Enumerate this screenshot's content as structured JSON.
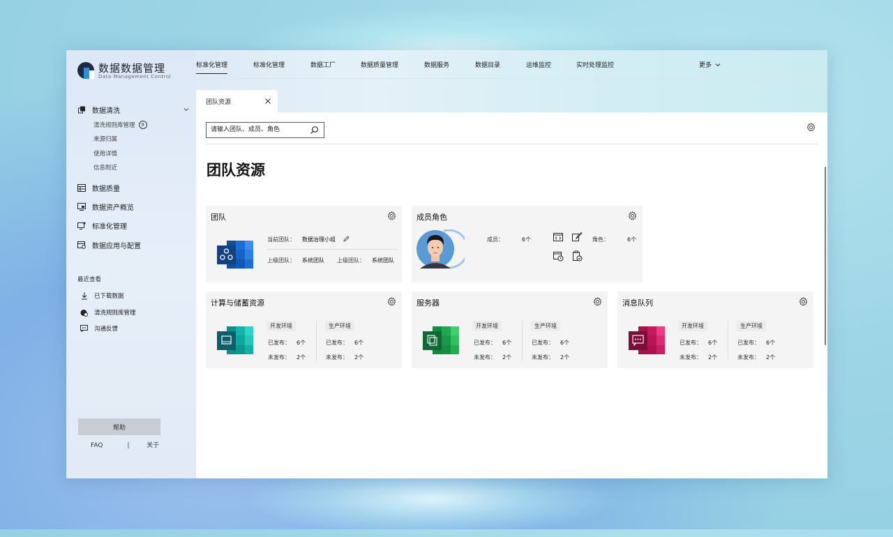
{
  "app": {
    "title": "数据数据管理",
    "subtitle": "Data Management Control"
  },
  "topnav": {
    "tabs": [
      "标准化管理",
      "标准化管理",
      "数据工厂",
      "数据质量管理",
      "数据服务",
      "数据目录",
      "运维监控",
      "实时处理监控"
    ],
    "more": "更多"
  },
  "sidebar": {
    "sections": [
      {
        "label": "数据清洗",
        "icon": "data-clean-icon",
        "children": [
          {
            "label": "清洗规则库管理",
            "badge": "9"
          },
          {
            "label": "来源归属"
          },
          {
            "label": "使用详情"
          },
          {
            "label": "信息附近"
          }
        ]
      },
      {
        "label": "数据质量",
        "icon": "data-quality-icon"
      },
      {
        "label": "数据资产概览",
        "icon": "asset-overview-icon"
      },
      {
        "label": "标准化管理",
        "icon": "standardization-icon"
      },
      {
        "label": "数据应用与配置",
        "icon": "app-config-icon"
      }
    ],
    "recent_title": "最近查看",
    "recent": [
      {
        "label": "已下载数据",
        "icon": "download-icon"
      },
      {
        "label": "清洗规则库管理",
        "icon": "rules-icon"
      },
      {
        "label": "沟通反馈",
        "icon": "chat-icon"
      }
    ],
    "help": "帮助",
    "faq": "FAQ",
    "sep": "|",
    "about": "关于"
  },
  "page_tab": {
    "label": "团队资源"
  },
  "search": {
    "placeholder": "请输入团队、成员、角色"
  },
  "page_title": "团队资源",
  "team_card": {
    "title": "团队",
    "current_team_label": "当前团队：",
    "current_team_value": "数据治理小组",
    "parent_team_label": "上级团队：",
    "parent_team_value": "系统团队",
    "parent_team_label2": "上级团队：",
    "parent_team_value2": "系统团队"
  },
  "member_card": {
    "title": "成员角色",
    "members_label": "成员：",
    "members_value": "6个",
    "roles_label": "角色：",
    "roles_value": "6个"
  },
  "resource_cards": [
    {
      "title": "计算与储蓄资源",
      "env1": "开发环境",
      "env2": "生产环境",
      "published": "已发布：",
      "unpublished": "未发布：",
      "dev_pub": "6个",
      "dev_unpub": "2个",
      "prod_pub": "6个",
      "prod_unpub": "2个",
      "color": "#10b3a8"
    },
    {
      "title": "服务器",
      "env1": "开发环境",
      "env2": "生产环境",
      "published": "已发布：",
      "unpublished": "未发布：",
      "dev_pub": "6个",
      "dev_unpub": "2个",
      "prod_pub": "6个",
      "prod_unpub": "2个",
      "color": "#1fa34f"
    },
    {
      "title": "消息队列",
      "env1": "开发环境",
      "env2": "生产环境",
      "published": "已发布：",
      "unpublished": "未发布：",
      "dev_pub": "6个",
      "dev_unpub": "2个",
      "prod_pub": "6个",
      "prod_unpub": "2个",
      "color": "#c8185d"
    }
  ]
}
